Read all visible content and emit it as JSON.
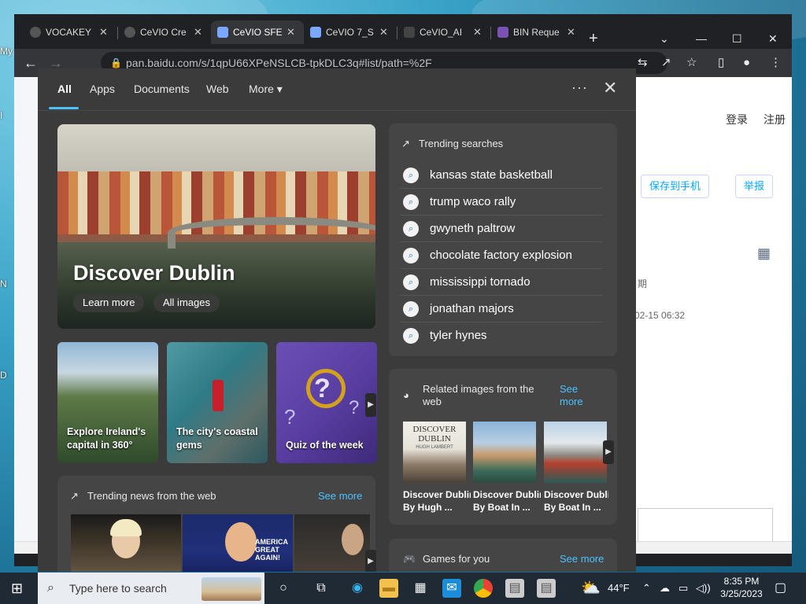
{
  "desktop": {
    "labels": [
      "My",
      "I",
      "N",
      "D"
    ]
  },
  "browser": {
    "tabs": [
      {
        "title": "VOCAKEY",
        "color": "#666"
      },
      {
        "title": "CeVIO Cre",
        "color": "#666"
      },
      {
        "title": "CeVIO SFE",
        "color": "#7aa7ff"
      },
      {
        "title": "CeVIO 7_S",
        "color": "#7aa7ff"
      },
      {
        "title": "CeVIO_AI",
        "color": "#333"
      },
      {
        "title": "BIN Reque",
        "color": "#7952b3"
      }
    ],
    "new_tab": "+",
    "url": "pan.baidu.com/s/1qpU66XPeNSLCB-tpkDLC3q#list/path=%2F",
    "window_controls": {
      "minimize": "—",
      "maximize": "☐",
      "close": "✕"
    }
  },
  "page": {
    "login": "登录",
    "register": "注册",
    "save_to_phone": "保存到手机",
    "report": "举报",
    "date_header": "期",
    "date_value": "02-15 06:32"
  },
  "flyout": {
    "nav": {
      "all": "All",
      "apps": "Apps",
      "documents": "Documents",
      "web": "Web",
      "more": "More ▾",
      "dots": "···",
      "close": "✕"
    },
    "hero": {
      "title": "Discover Dublin",
      "learn_more": "Learn more",
      "all_images": "All images"
    },
    "thumbs": [
      {
        "caption1": "Explore Ireland's",
        "caption2": "capital in 360°"
      },
      {
        "caption1": "The city's coastal",
        "caption2": "gems"
      },
      {
        "caption1": "Quiz of the week",
        "caption2": ""
      }
    ],
    "trending": {
      "title": "Trending searches",
      "items": [
        "kansas state basketball",
        "trump waco rally",
        "gwyneth paltrow",
        "chocolate factory explosion",
        "mississippi tornado",
        "jonathan majors",
        "tyler hynes"
      ]
    },
    "related": {
      "title1": "Related images from the",
      "title2": "web",
      "see_more1": "See",
      "see_more2": "more",
      "book_title": "DISCOVER DUBLIN",
      "book_author": "HUGH LAMBERT",
      "items": [
        {
          "line1": "Discover Dublin",
          "line2": "By Hugh ..."
        },
        {
          "line1": "Discover Dublin",
          "line2": "By Boat In ..."
        },
        {
          "line1": "Discover Dublin",
          "line2": "By Boat In ..."
        }
      ]
    },
    "news": {
      "title": "Trending news from the web",
      "see_more": "See more",
      "banner": "AMERICA GREAT AGAIN!"
    },
    "games": {
      "title": "Games for you",
      "see_more": "See more"
    }
  },
  "taskbar": {
    "search_placeholder": "Type here to search",
    "weather": "44°F",
    "time": "8:35 PM",
    "date": "3/25/2023"
  }
}
